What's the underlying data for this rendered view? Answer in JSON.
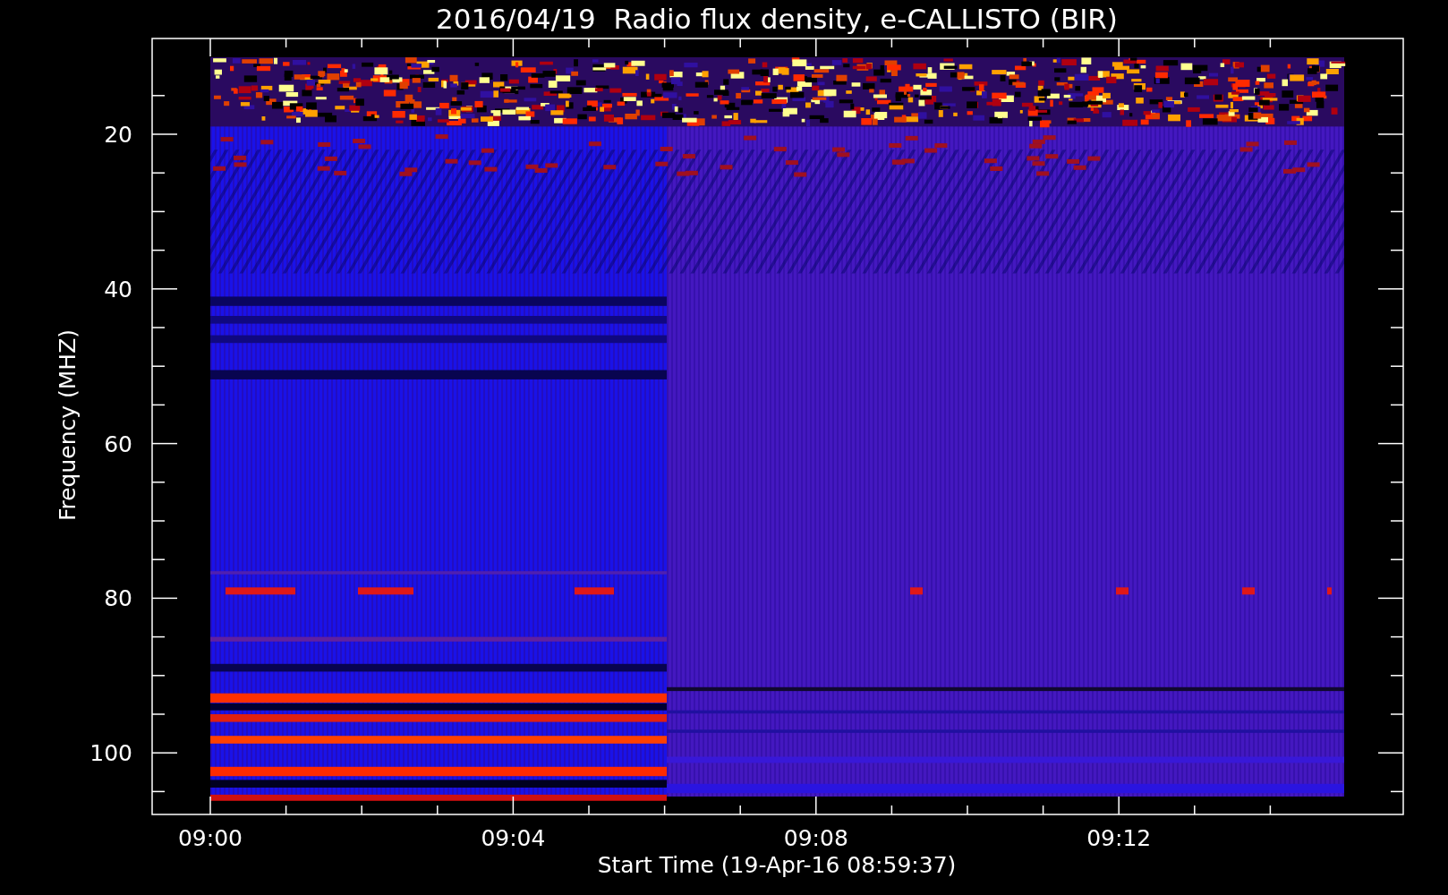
{
  "title": "2016/04/19  Radio flux density, e-CALLISTO (BIR)",
  "x_axis": {
    "label": "Start Time (19-Apr-16 08:59:37)",
    "ticks": [
      "09:00",
      "09:04",
      "09:08",
      "09:12"
    ]
  },
  "y_axis": {
    "label": "Frequency (MHZ)",
    "ticks": [
      "20",
      "40",
      "60",
      "80",
      "100"
    ]
  }
}
